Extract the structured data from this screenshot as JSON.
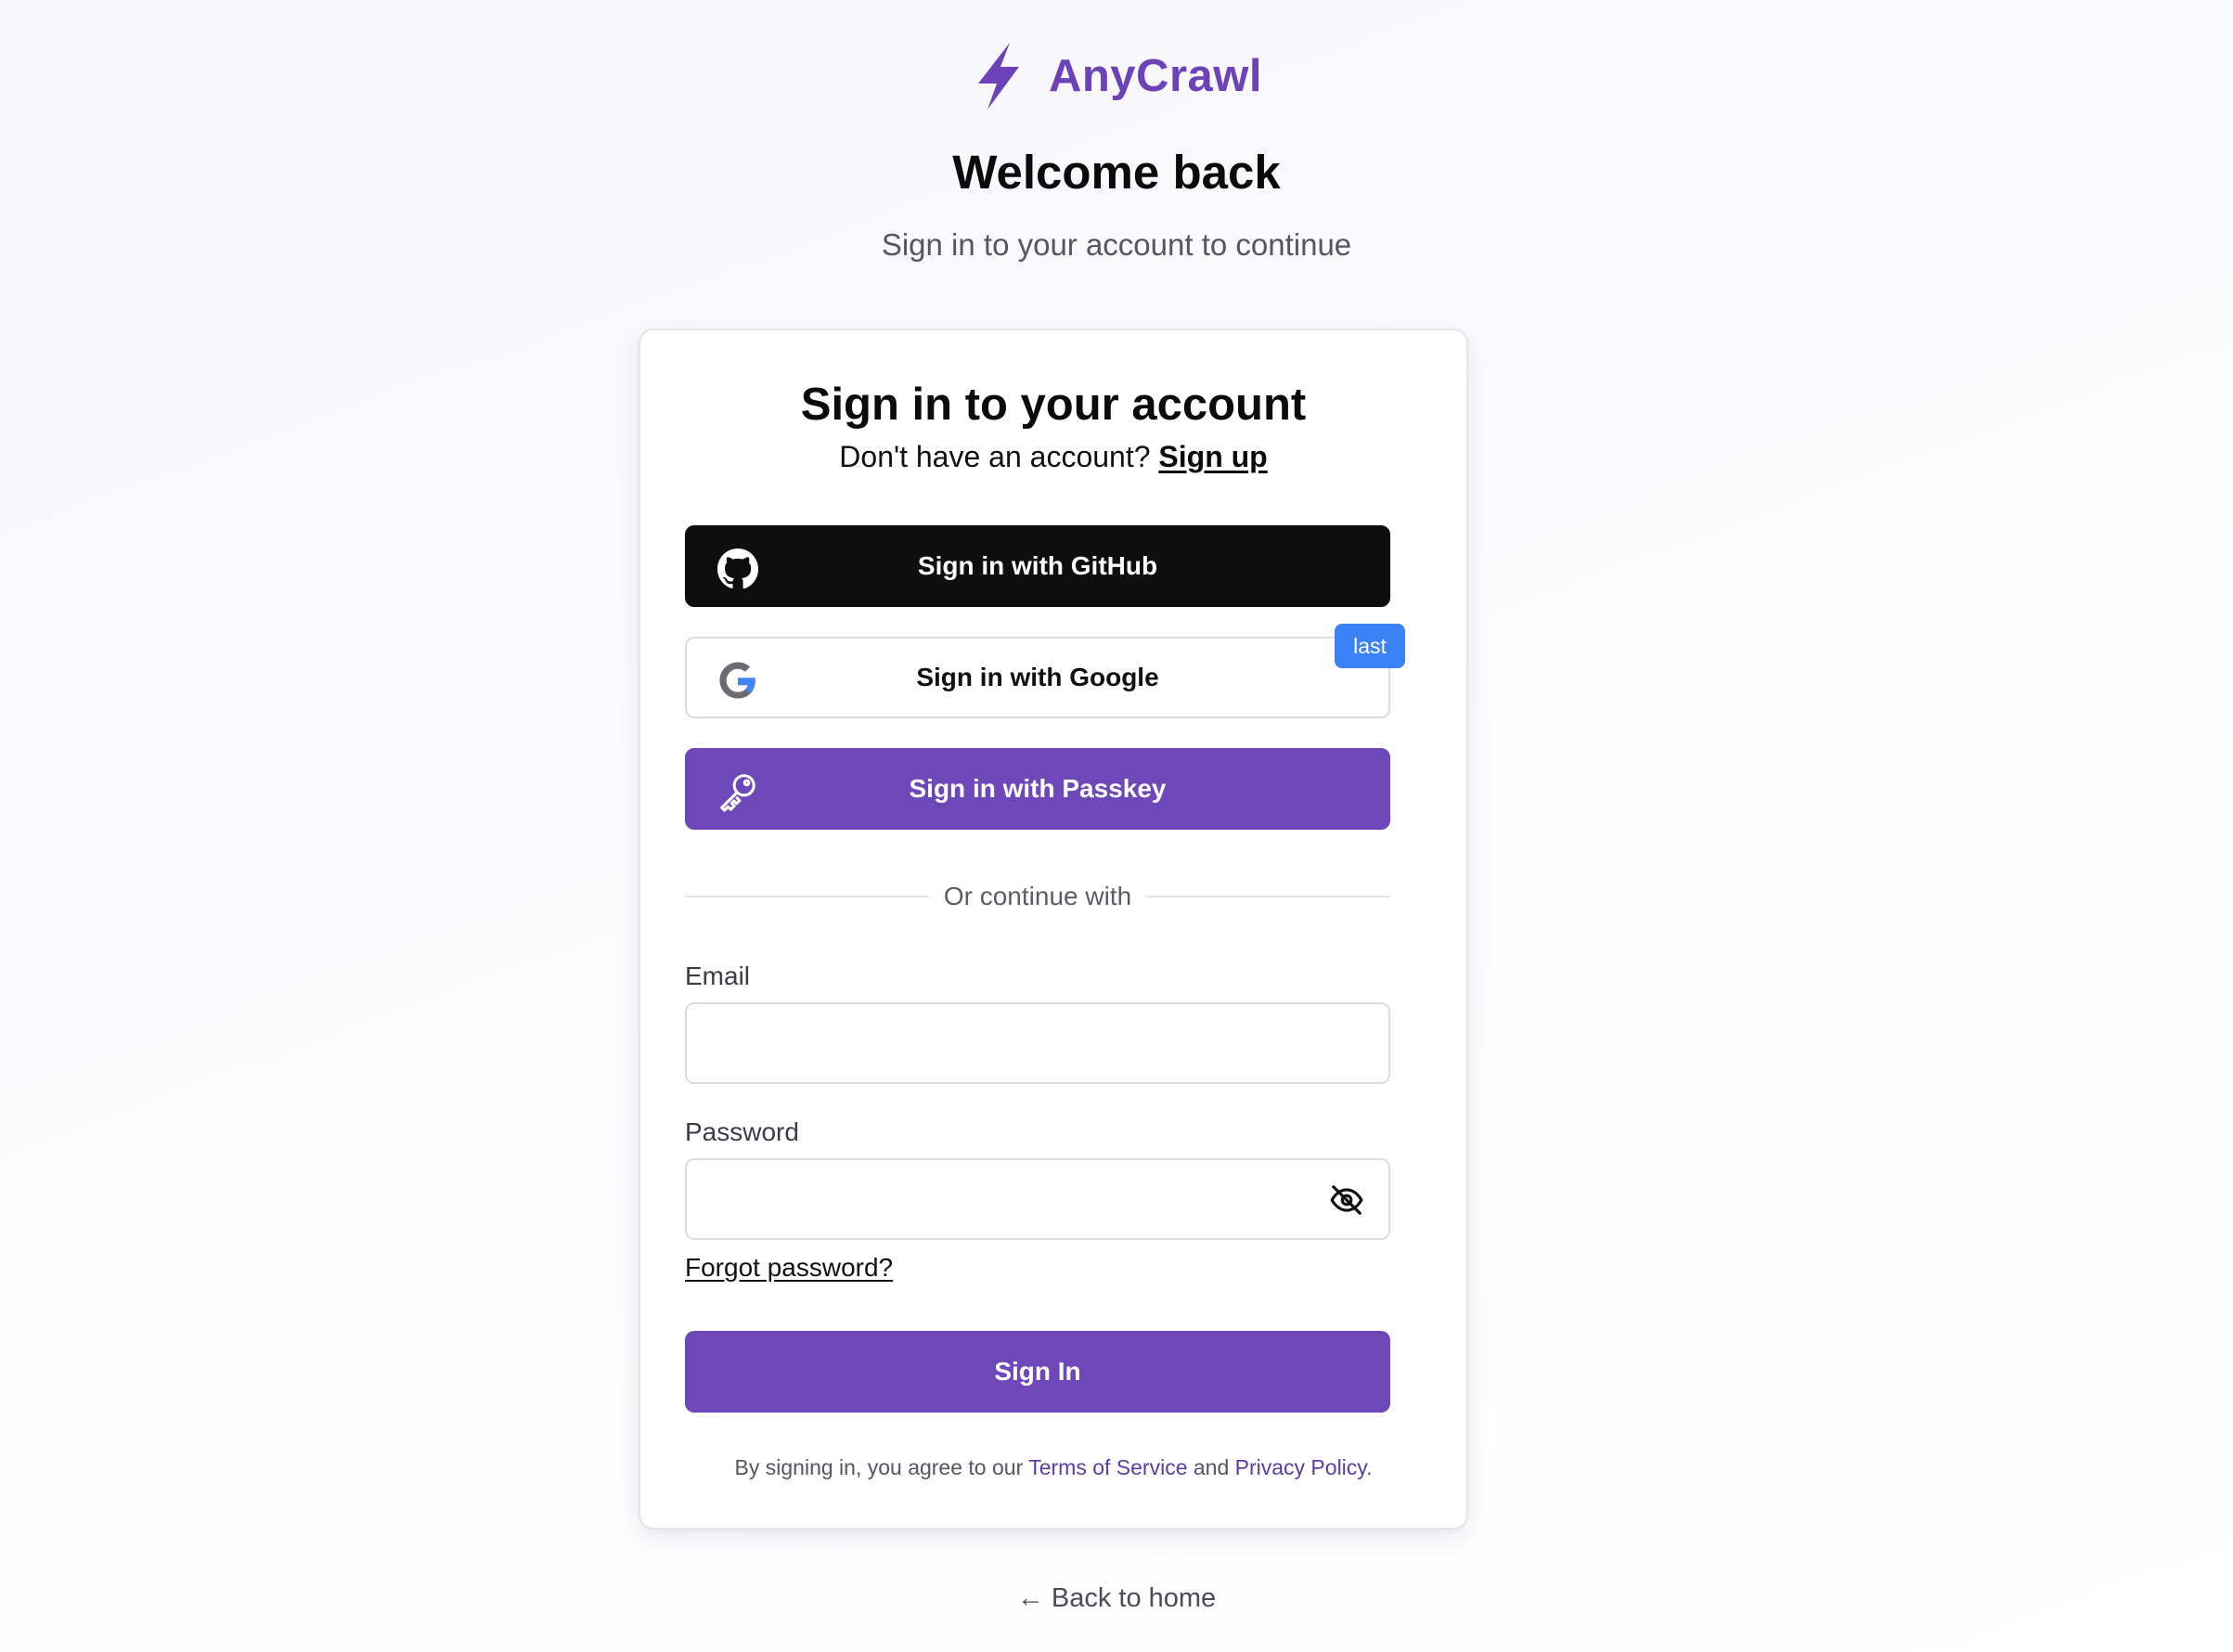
{
  "brand": {
    "name": "AnyCrawl",
    "icon": "lightning-bolt-icon",
    "color": "#6b42b8"
  },
  "header": {
    "title": "Welcome back",
    "subtitle": "Sign in to your account to continue"
  },
  "card": {
    "title": "Sign in to your account",
    "no_account_text": "Don't have an account?",
    "signup_link": "Sign up",
    "github_button": "Sign in with GitHub",
    "google_button": "Sign in with Google",
    "passkey_button": "Sign in with Passkey",
    "last_badge": "last",
    "divider_text": "Or continue with",
    "email_label": "Email",
    "email_value": "",
    "password_label": "Password",
    "password_value": "",
    "forgot_password": "Forgot password?",
    "signin_button": "Sign In",
    "terms_prefix": "By signing in, you agree to our",
    "terms_link": "Terms of Service",
    "terms_and": "and",
    "privacy_link": "Privacy Policy",
    "terms_suffix": "."
  },
  "footer": {
    "back_home": "← Back to home"
  },
  "colors": {
    "accent": "#6e48b8",
    "github_bg": "#0e0e0f",
    "badge_blue": "#3b82f6"
  }
}
